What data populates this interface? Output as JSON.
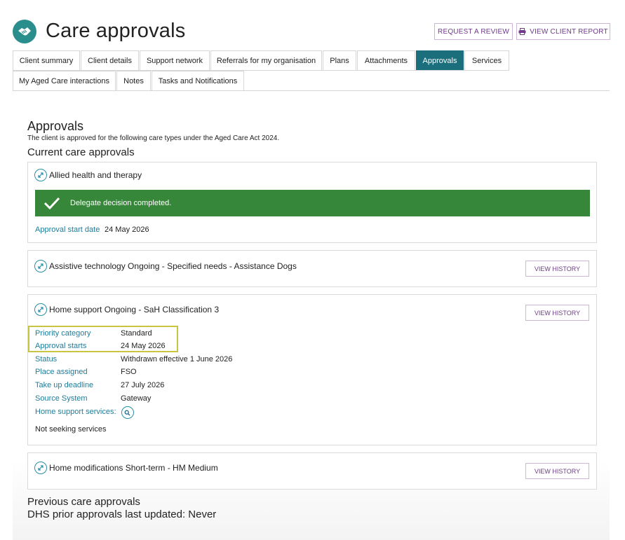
{
  "header": {
    "title": "Care approvals",
    "logo_icon": "handshake-icon",
    "request_review_label": "REQUEST A REVIEW",
    "view_report_label": "VIEW CLIENT REPORT",
    "view_report_icon": "printer-icon"
  },
  "tabs": {
    "row1": [
      "Client summary",
      "Client details",
      "Support network",
      "Referrals for my organisation",
      "Plans",
      "Attachments",
      "Approvals",
      "Services"
    ],
    "row2": [
      "My Aged Care interactions",
      "Notes",
      "Tasks and Notifications"
    ],
    "active": "Approvals"
  },
  "main": {
    "heading": "Approvals",
    "intro": "The client is approved for the following care types under the Aged Care Act 2024.",
    "current_heading": "Current care approvals",
    "previous_heading": "Previous care approvals",
    "dhs_line": "DHS prior approvals last updated: Never"
  },
  "cards": {
    "allied": {
      "title": "Allied health and therapy",
      "banner": "Delegate decision completed.",
      "start_label": "Approval start date",
      "start_value": "24 May 2026"
    },
    "assistive": {
      "title": "Assistive technology Ongoing - Specified needs - Assistance Dogs",
      "button": "VIEW HISTORY"
    },
    "home_support": {
      "title": "Home support Ongoing - SaH Classification 3",
      "button": "VIEW HISTORY",
      "fields": [
        {
          "label": "Priority category",
          "value": "Standard"
        },
        {
          "label": "Approval starts",
          "value": "24 May 2026"
        },
        {
          "label": "Status",
          "value": "Withdrawn effective 1 June 2026"
        },
        {
          "label": "Place assigned",
          "value": "FSO"
        },
        {
          "label": "Take up deadline",
          "value": "27 July 2026"
        },
        {
          "label": "Source System",
          "value": "Gateway"
        }
      ],
      "services_label": "Home support services:",
      "not_seeking": "Not seeking services"
    },
    "home_mod": {
      "title": "Home modifications Short-term - HM Medium",
      "button": "VIEW HISTORY"
    }
  },
  "colors": {
    "active_tab": "#1b6f7c",
    "banner_green": "#37873a",
    "label_teal": "#1f7c99",
    "button_purple": "#6f3a89",
    "highlight": "#c9c441"
  }
}
